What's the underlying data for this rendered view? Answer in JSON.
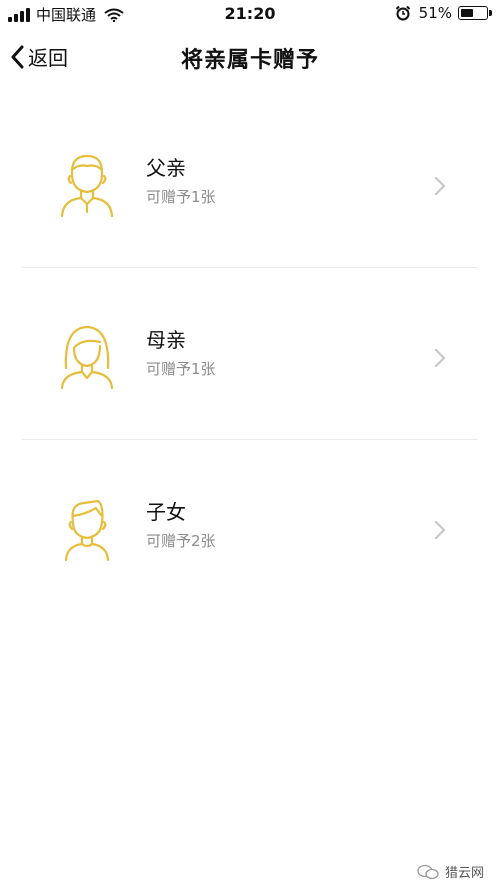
{
  "status_bar": {
    "carrier": "中国联通",
    "time": "21:20",
    "battery_percent": "51%",
    "battery_level": 0.51
  },
  "nav": {
    "back_label": "返回",
    "title": "将亲属卡赠予"
  },
  "items": [
    {
      "title": "父亲",
      "subtitle": "可赠予1张",
      "avatar": "father-avatar-icon"
    },
    {
      "title": "母亲",
      "subtitle": "可赠予1张",
      "avatar": "mother-avatar-icon"
    },
    {
      "title": "子女",
      "subtitle": "可赠予2张",
      "avatar": "child-avatar-icon"
    }
  ],
  "watermark": {
    "text": "猎云网"
  },
  "colors": {
    "accent": "#E6BE3C",
    "text": "#111111",
    "subtext": "#8C8C8C",
    "chevron": "#C7C7CC",
    "divider": "#ECECEC"
  }
}
